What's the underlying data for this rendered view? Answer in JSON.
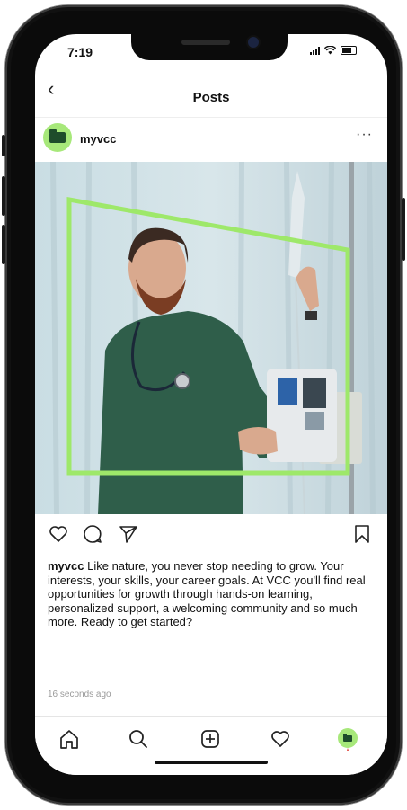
{
  "status": {
    "time": "7:19"
  },
  "nav": {
    "title": "Posts",
    "back_icon": "chevron-left-icon"
  },
  "post": {
    "username": "myvcc",
    "more_icon": "more-horizontal-icon",
    "caption_user": "myvcc",
    "caption_text": "Like nature, you never stop needing to grow. Your interests, your skills, your career goals. At VCC you'll find real opportunities for growth through hands-on learning, personalized support, a welcoming community and so much more. Ready to get started?",
    "timestamp": "16 seconds ago"
  },
  "actions": {
    "like_icon": "heart-icon",
    "comment_icon": "comment-icon",
    "share_icon": "send-icon",
    "save_icon": "bookmark-icon"
  },
  "tabs": [
    {
      "icon": "home-icon"
    },
    {
      "icon": "search-icon"
    },
    {
      "icon": "add-post-icon"
    },
    {
      "icon": "activity-heart-icon"
    },
    {
      "icon": "profile-avatar-icon"
    }
  ],
  "colors": {
    "brand_green": "#a7e87a",
    "folder_dark_green": "#1e4d2b",
    "outline_green": "#9ee86a",
    "scrub_green": "#2f5e4a"
  }
}
